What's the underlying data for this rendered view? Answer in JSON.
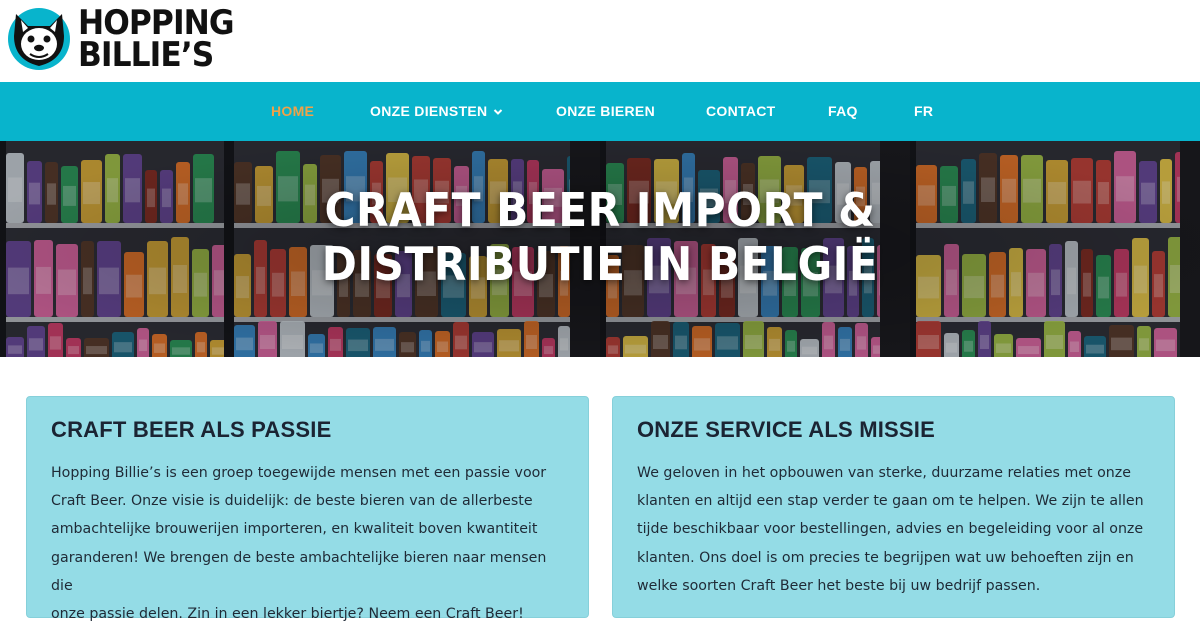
{
  "brand": {
    "name_line1": "HOPPING",
    "name_line2": "BILLIE’S",
    "logo_icon": "bulldog-icon",
    "colors": {
      "teal": "#08b4cc",
      "dark": "#111111"
    }
  },
  "nav": {
    "items": [
      {
        "label": "HOME",
        "active": true
      },
      {
        "label": "ONZE DIENSTEN",
        "has_dropdown": true,
        "icon": "chevron-down-icon"
      },
      {
        "label": "ONZE BIEREN"
      },
      {
        "label": "CONTACT"
      },
      {
        "label": "FAQ"
      },
      {
        "label": "FR"
      }
    ],
    "colors": {
      "background": "#08b4cc",
      "text": "#ffffff",
      "active": "#f0a248"
    }
  },
  "hero": {
    "title_line1": "CRAFT BEER IMPORT &",
    "title_line2": "DISTRIBUTIE IN BELGIË"
  },
  "cards": [
    {
      "title": "CRAFT BEER ALS PASSIE",
      "lines": [
        "Hopping Billie’s is een groep toegewijde mensen met een passie voor",
        "Craft Beer. Onze visie is duidelijk: de beste bieren van de allerbeste",
        "ambachtelijke brouwerijen importeren, en kwaliteit boven kwantiteit",
        "garanderen! We brengen de beste ambachtelijke bieren naar mensen die",
        "onze passie delen. Zin in een lekker biertje? Neem een Craft Beer!"
      ]
    },
    {
      "title": "ONZE SERVICE ALS MISSIE",
      "lines": [
        "We geloven in het opbouwen van sterke, duurzame relaties met onze",
        "klanten en altijd een stap verder te gaan om te helpen. We zijn te allen",
        "tijde beschikbaar voor bestellingen, advies en begeleiding voor al onze",
        "klanten. Ons doel is om precies te begrijpen wat uw behoeften zijn en",
        "welke soorten Craft Beer het beste bij uw bedrijf passen."
      ]
    }
  ],
  "cards_color": "#94dce6"
}
